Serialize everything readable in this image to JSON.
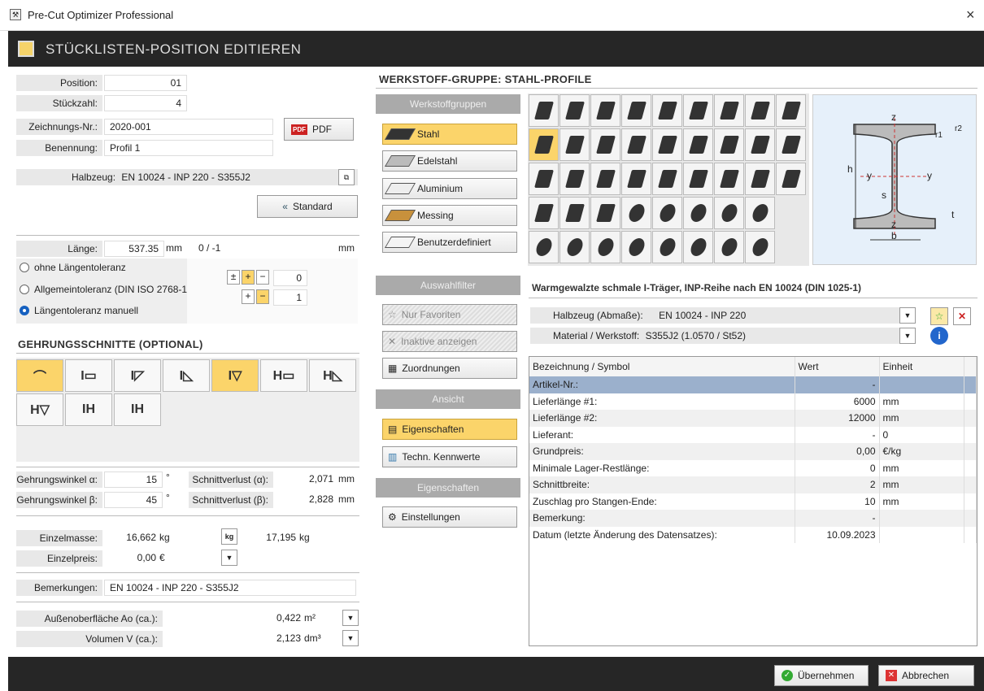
{
  "window": {
    "title": "Pre-Cut Optimizer Professional",
    "close": "×"
  },
  "header": {
    "title": "STÜCKLISTEN-POSITION EDITIEREN"
  },
  "left": {
    "position_label": "Position:",
    "position_value": "01",
    "stueckzahl_label": "Stückzahl:",
    "stueckzahl_value": "4",
    "zeichnung_label": "Zeichnungs-Nr.:",
    "zeichnung_value": "2020-001",
    "pdf_label": "PDF",
    "benennung_label": "Benennung:",
    "benennung_value": "Profil 1",
    "halbzeug_label": "Halbzeug:",
    "halbzeug_value": "EN 10024 - INP 220 - S355J2",
    "standard_label": "Standard",
    "laenge_label": "Länge:",
    "laenge_value": "537.35",
    "laenge_unit": "mm",
    "laenge_tol": "0 / -1",
    "laenge_tol_unit": "mm",
    "tol_options": [
      "ohne Längentoleranz",
      "Allgemeintoleranz (DIN ISO 2768-1)",
      "Längentoleranz manuell"
    ],
    "tol_upper": "0",
    "tol_lower": "1",
    "tol_pm": "±",
    "tol_plus": "+",
    "tol_minus": "−",
    "gehrung_title": "GEHRUNGSSCHNITTE (OPTIONAL)",
    "alpha_label": "Gehrungswinkel α:",
    "alpha_value": "15",
    "alpha_unit": "°",
    "beta_label": "Gehrungswinkel β:",
    "beta_value": "45",
    "beta_unit": "°",
    "sv_alpha_label": "Schnittverlust (α):",
    "sv_alpha_value": "2,071",
    "sv_alpha_unit": "mm",
    "sv_beta_label": "Schnittverlust (β):",
    "sv_beta_value": "2,828",
    "sv_beta_unit": "mm",
    "einzelmasse_label": "Einzelmasse:",
    "einzelmasse_value": "16,662",
    "einzelmasse_unit": "kg",
    "kg_icon": "kg",
    "masse2_value": "17,195",
    "masse2_unit": "kg",
    "einzelpreis_label": "Einzelpreis:",
    "einzelpreis_value": "0,00",
    "einzelpreis_unit": "€",
    "bemerkungen_label": "Bemerkungen:",
    "bemerkungen_value": "EN 10024 - INP 220 - S355J2",
    "oberflaeche_label": "Außenoberfläche Ao (ca.):",
    "oberflaeche_value": "0,422",
    "oberflaeche_unit": "m²",
    "volumen_label": "Volumen V (ca.):",
    "volumen_value": "2,123",
    "volumen_unit": "dm³"
  },
  "middle": {
    "werkstoff_title": "WERKSTOFF-GRUPPE: STAHL-PROFILE",
    "werkstoffgruppen": "Werkstoffgruppen",
    "groups": [
      "Stahl",
      "Edelstahl",
      "Aluminium",
      "Messing",
      "Benutzerdefiniert"
    ],
    "group_colors": [
      "#333333",
      "#bbbbbb",
      "#eeeeee",
      "#c8913c",
      "#f4f4f4"
    ],
    "auswahlfilter": "Auswahlfilter",
    "nur_favoriten": "Nur Favoriten",
    "inaktive": "Inaktive anzeigen",
    "zuordnungen": "Zuordnungen",
    "ansicht": "Ansicht",
    "eigenschaften_btn": "Eigenschaften",
    "techn": "Techn. Kennwerte",
    "eigenschaften_hdr": "Eigenschaften",
    "einstellungen": "Einstellungen"
  },
  "right": {
    "desc": "Warmgewalzte schmale I-Träger, INP-Reihe nach EN 10024 (DIN 1025-1)",
    "halbzeug_label": "Halbzeug (Abmaße):",
    "halbzeug_value": "EN 10024 - INP 220",
    "material_label": "Material / Werkstoff:",
    "material_value": "S355J2  (1.0570 / St52)",
    "diagram": {
      "z": "z",
      "y": "y",
      "h": "h",
      "b": "b",
      "s": "s",
      "t": "t",
      "r1": "r1",
      "r2": "r2"
    },
    "table": {
      "headers": [
        "Bezeichnung / Symbol",
        "Wert",
        "Einheit"
      ],
      "rows": [
        [
          "Artikel-Nr.:",
          "-",
          ""
        ],
        [
          "Lieferlänge #1:",
          "6000",
          "mm"
        ],
        [
          "Lieferlänge #2:",
          "12000",
          "mm"
        ],
        [
          "Lieferant:",
          "-",
          "0"
        ],
        [
          "Grundpreis:",
          "0,00",
          "€/kg"
        ],
        [
          "Minimale Lager-Restlänge:",
          "0",
          "mm"
        ],
        [
          "Schnittbreite:",
          "2",
          "mm"
        ],
        [
          "Zuschlag pro Stangen-Ende:",
          "10",
          "mm"
        ],
        [
          "Bemerkung:",
          "-",
          ""
        ],
        [
          "Datum (letzte Änderung des Datensatzes):",
          "10.09.2023",
          ""
        ]
      ]
    }
  },
  "footer": {
    "ok": "Übernehmen",
    "cancel": "Abbrechen"
  }
}
